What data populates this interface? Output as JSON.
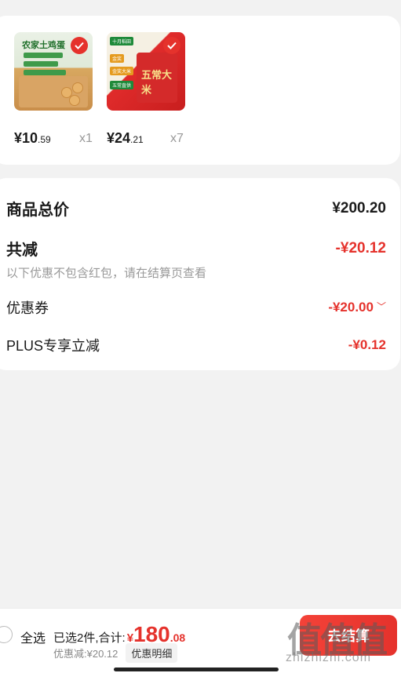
{
  "products": [
    {
      "price_int": "¥10",
      "price_dec": ".59",
      "qty": "x1",
      "thumb_text": "农家土鸡蛋"
    },
    {
      "price_int": "¥24",
      "price_dec": ".21",
      "qty": "x7",
      "thumb_text": "五常大米"
    }
  ],
  "summary": {
    "total_label": "商品总价",
    "total_value": "¥200.20",
    "discount_label": "共减",
    "discount_value": "-¥20.12",
    "note": "以下优惠不包含红包，请在结算页查看",
    "coupon_label": "优惠券",
    "coupon_value": "-¥20.00",
    "plus_label": "PLUS专享立减",
    "plus_value": "-¥0.12"
  },
  "bottom": {
    "select_all": "全选",
    "selected_text": "已选2件,合计:",
    "currency": "¥",
    "total_int": "180",
    "total_dec": ".08",
    "discount_text": "优惠减:¥20.12",
    "detail_button": "优惠明细",
    "checkout_button": "去结算"
  },
  "watermark": {
    "logo": "值值值",
    "url": "zhizhizhi.com"
  },
  "colors": {
    "accent": "#e5322c",
    "muted": "#999999"
  }
}
